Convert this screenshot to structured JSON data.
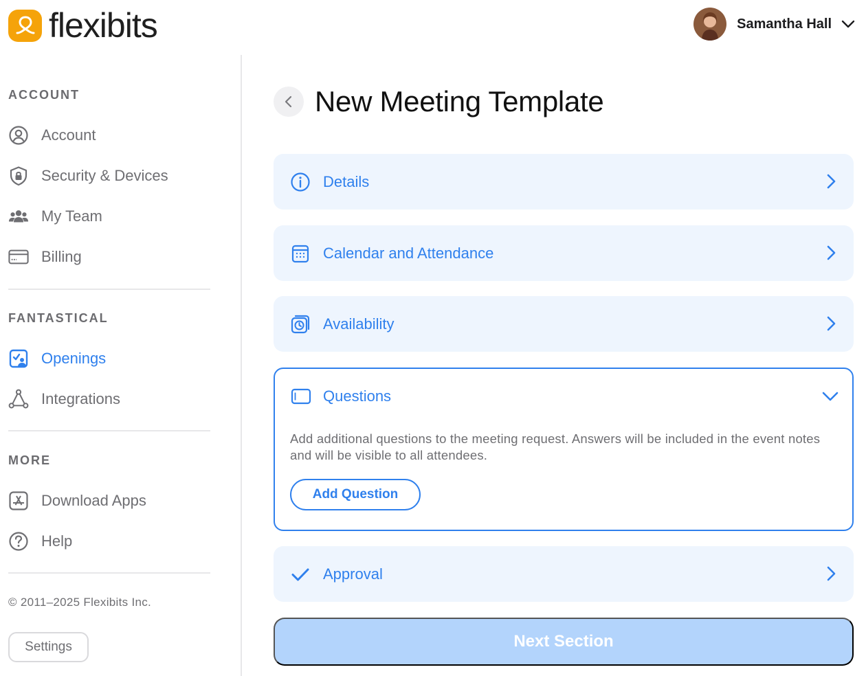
{
  "brand": {
    "name": "flexibits",
    "accent": "#f5a30a"
  },
  "user": {
    "name": "Samantha Hall"
  },
  "sidebar": {
    "sections": [
      {
        "title": "ACCOUNT",
        "items": [
          {
            "label": "Account",
            "icon": "user-circle-icon"
          },
          {
            "label": "Security & Devices",
            "icon": "shield-lock-icon"
          },
          {
            "label": "My Team",
            "icon": "team-icon"
          },
          {
            "label": "Billing",
            "icon": "credit-card-icon"
          }
        ]
      },
      {
        "title": "FANTASTICAL",
        "items": [
          {
            "label": "Openings",
            "icon": "openings-icon",
            "active": true
          },
          {
            "label": "Integrations",
            "icon": "integrations-icon"
          }
        ]
      },
      {
        "title": "MORE",
        "items": [
          {
            "label": "Download Apps",
            "icon": "app-store-icon"
          },
          {
            "label": "Help",
            "icon": "help-icon"
          }
        ]
      }
    ],
    "copyright": "© 2011–2025 Flexibits Inc.",
    "settings_label": "Settings"
  },
  "main": {
    "title": "New Meeting Template",
    "sections": [
      {
        "label": "Details",
        "icon": "info-icon"
      },
      {
        "label": "Calendar and Attendance",
        "icon": "calendar-icon"
      },
      {
        "label": "Availability",
        "icon": "availability-icon"
      },
      {
        "label": "Questions",
        "icon": "questions-icon",
        "expanded": true,
        "description": "Add additional questions to the meeting request. Answers will be included in the event notes and will be visible to all attendees.",
        "button": "Add Question"
      },
      {
        "label": "Approval",
        "icon": "checkmark-icon"
      }
    ],
    "next_button": "Next Section"
  },
  "colors": {
    "primary": "#2f80ed",
    "card_bg": "#eef5fe",
    "disabled_button": "#b3d4fc",
    "muted_text": "#6e6e72"
  }
}
